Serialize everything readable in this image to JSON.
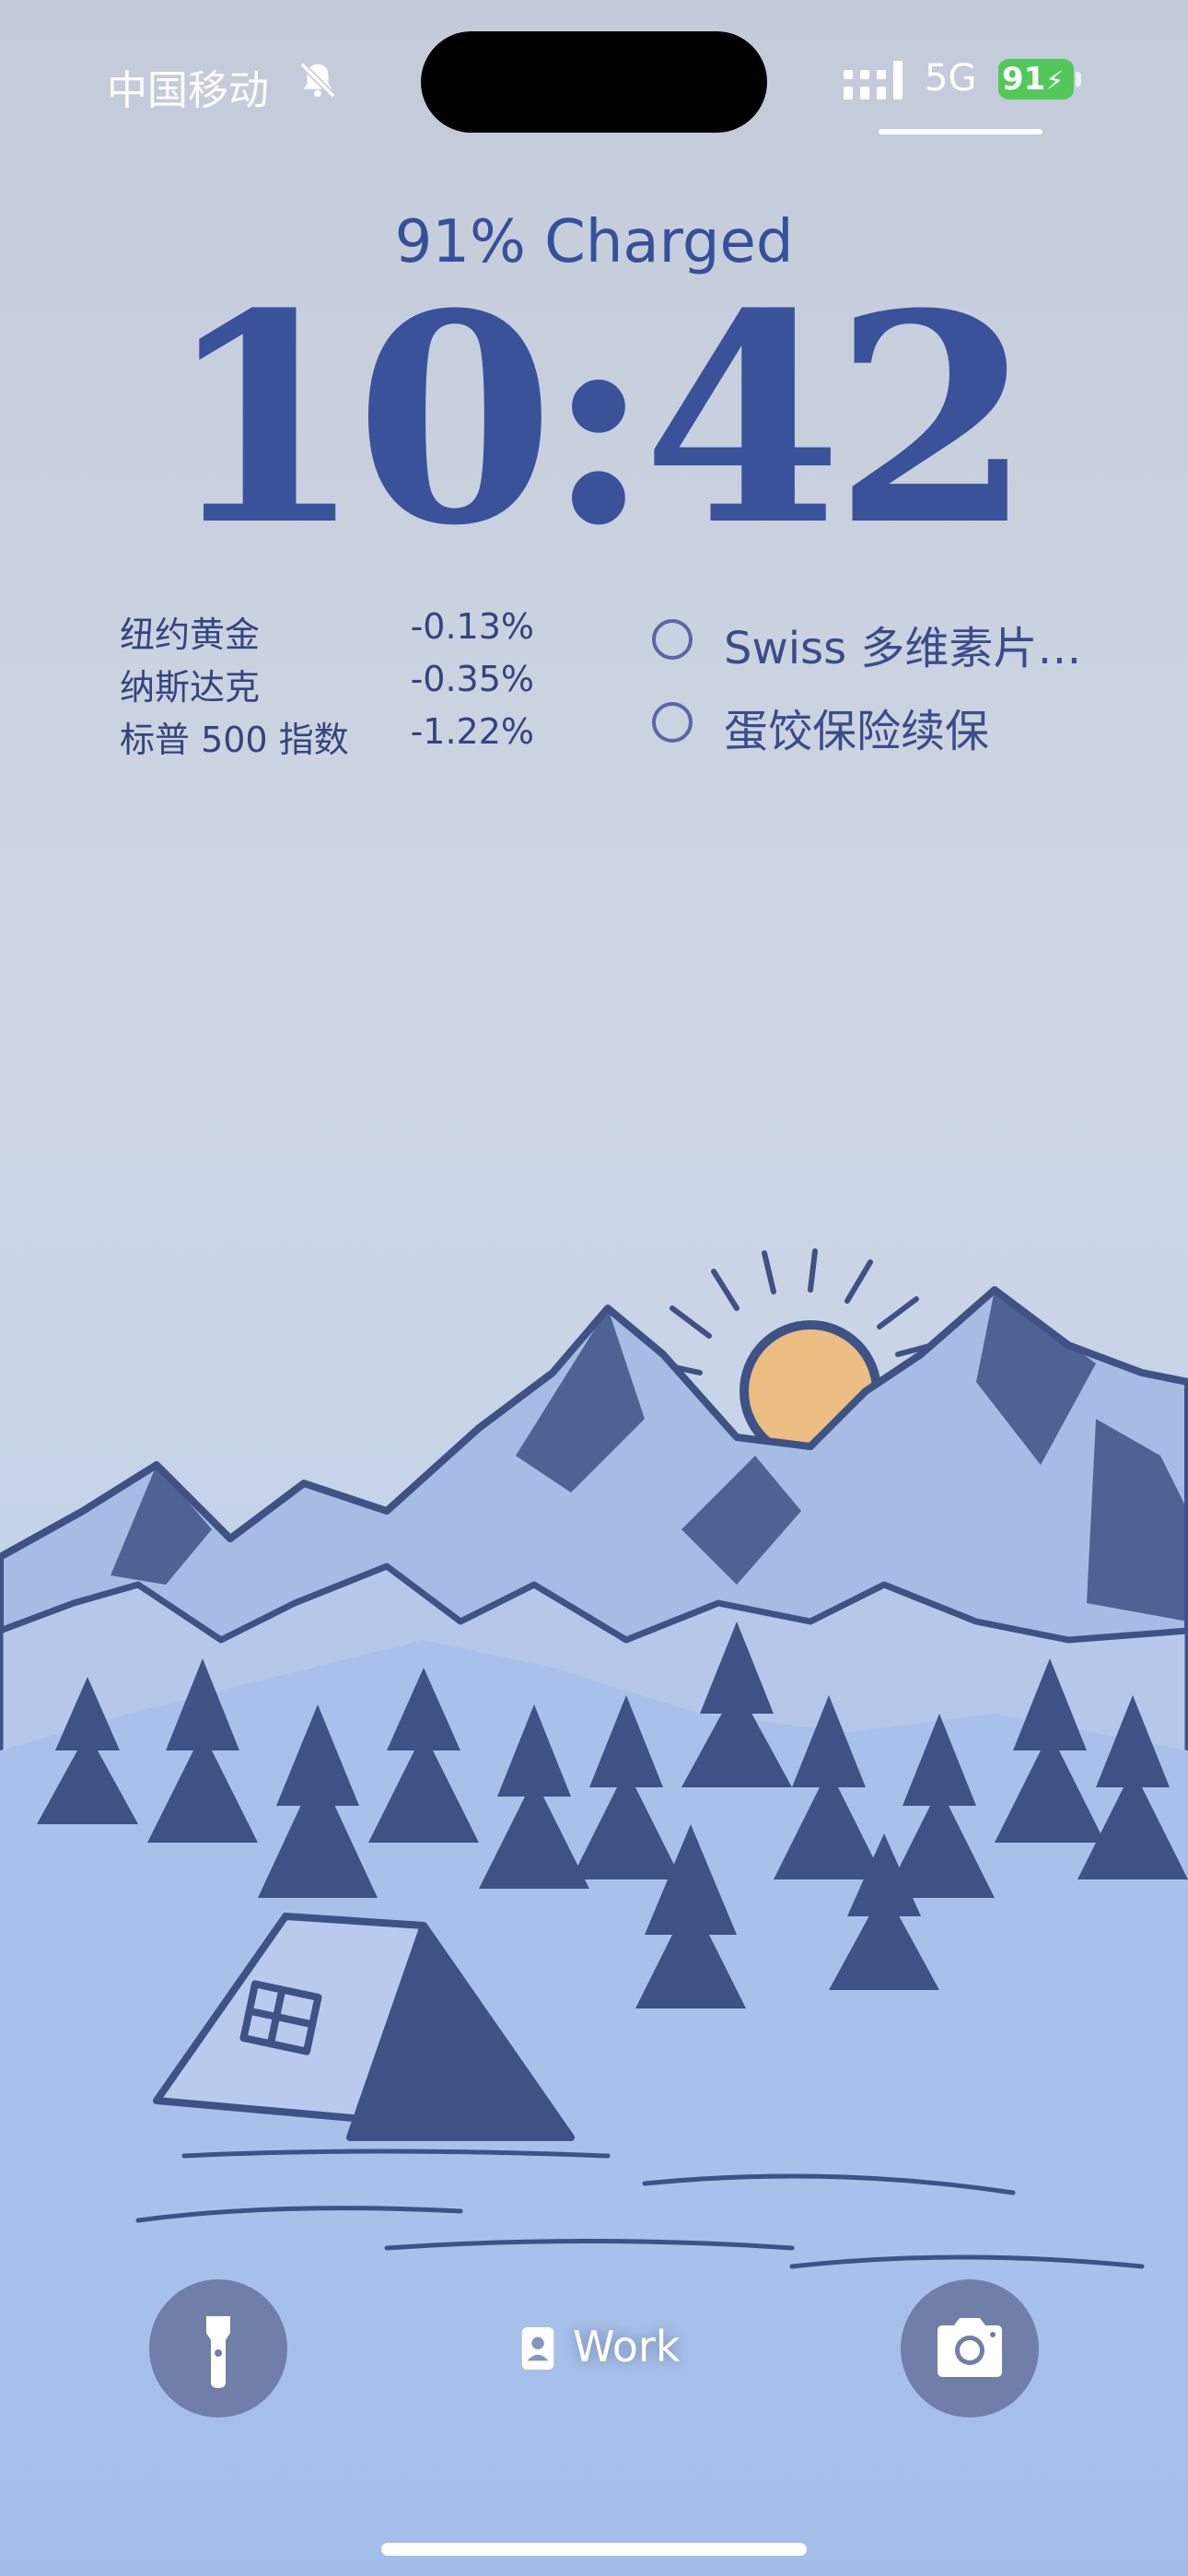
{
  "status_bar": {
    "carrier": "中国移动",
    "network": "5G",
    "battery": "91",
    "silent_icon": "bell-slash-icon",
    "signal_icon": "signal-bars-icon",
    "charging_icon": "bolt-icon",
    "battery_color": "#52c85a"
  },
  "lock_screen": {
    "charge_status": "91% Charged",
    "time": "10:42",
    "clock_color": "#3a529a"
  },
  "stocks_widget": {
    "rows": [
      {
        "name": "纽约黄金",
        "change": "-0.13%"
      },
      {
        "name": "纳斯达克",
        "change": "-0.35%"
      },
      {
        "name": "标普 500 指数",
        "change": "-1.22%"
      }
    ]
  },
  "reminders_widget": {
    "items": [
      {
        "text": "Swiss 多维素片…"
      },
      {
        "text": "蛋饺保险续保"
      }
    ]
  },
  "bottom": {
    "flashlight_icon": "flashlight-icon",
    "camera_icon": "camera-icon",
    "focus_icon": "person-badge-icon",
    "focus_label": "Work"
  },
  "wallpaper": {
    "subject": "mountains-sunrise-tent",
    "sun_color": "#ebbd82",
    "ink_color": "#3e5285"
  }
}
